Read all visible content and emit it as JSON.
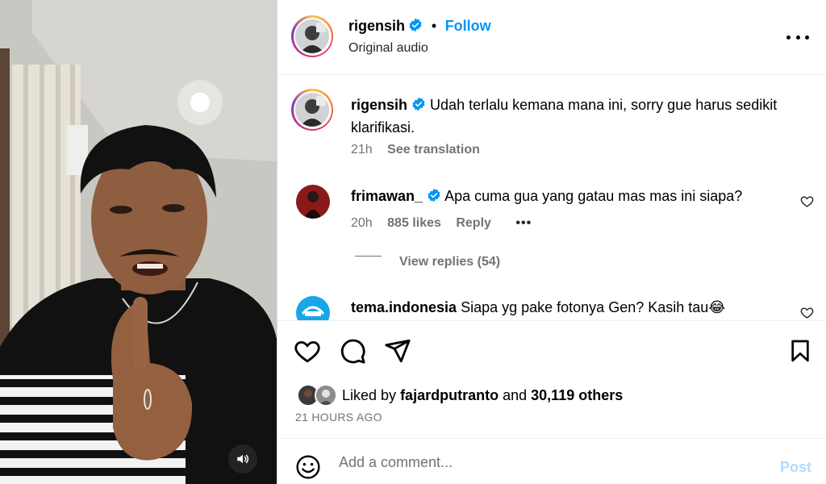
{
  "media": {
    "sound_button_icon": "speaker-icon"
  },
  "header": {
    "username": "rigensih",
    "separator": "•",
    "follow_label": "Follow",
    "subtitle": "Original audio",
    "more_icon": "more-horizontal-icon"
  },
  "caption": {
    "username": "rigensih",
    "text": "Udah terlalu kemana mana ini, sorry gue harus sedikit klarifikasi.",
    "time": "21h",
    "translate_label": "See translation"
  },
  "comments": [
    {
      "username": "frimawan_",
      "text": "Apa cuma gua yang gatau mas mas ini siapa?",
      "time": "20h",
      "likes": "885 likes",
      "reply_label": "Reply",
      "view_replies": "View replies (54)"
    },
    {
      "username": "tema.indonesia",
      "text": "Siapa yg pake fotonya Gen? Kasih tau😂"
    }
  ],
  "actions": {
    "liked_prefix": "Liked by",
    "liked_user": "fajardputranto",
    "liked_and": "and",
    "liked_others": "30,119 others",
    "timestamp": "21 HOURS AGO"
  },
  "composer": {
    "placeholder": "Add a comment...",
    "post_label": "Post"
  },
  "colors": {
    "link_blue": "#0095f6",
    "verified_blue": "#0095f6",
    "muted_gray": "#737373",
    "post_disabled": "#b3dbff"
  }
}
